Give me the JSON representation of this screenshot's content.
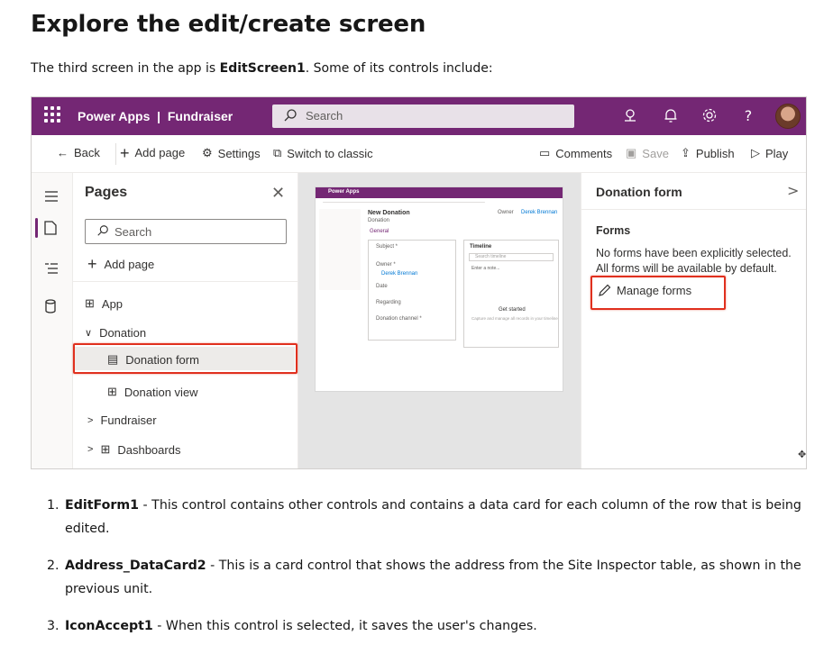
{
  "heading": "Explore the edit/create screen",
  "intro": {
    "before": "The third screen in the app is ",
    "bold": "EditScreen1",
    "after": ". Some of its controls include:"
  },
  "screenshot": {
    "topbar": {
      "app_name": "Power Apps  |  Fundraiser",
      "search_placeholder": "Search",
      "help_glyph": "?"
    },
    "commands": {
      "back": "Back",
      "add_page": "Add page",
      "settings": "Settings",
      "switch": "Switch to classic",
      "comments": "Comments",
      "save": "Save",
      "publish": "Publish",
      "play": "Play"
    },
    "pages_panel": {
      "title": "Pages",
      "search_placeholder": "Search",
      "add_page": "Add page",
      "items": [
        "App",
        "Donation",
        "Donation form",
        "Donation view",
        "Fundraiser",
        "Dashboards"
      ]
    },
    "canvas_preview": {
      "app_label": "Power Apps",
      "form_title": "New Donation",
      "form_subtitle": "Donation",
      "tab": "General",
      "owner_label": "Owner",
      "owner_value": "Derek Brennan",
      "fields": [
        "Subject *",
        "Owner *",
        "Derek Brennan",
        "Date",
        "Regarding",
        "Donation channel *"
      ],
      "timeline": "Timeline",
      "timeline_search": "Search timeline",
      "timeline_note": "Enter a note...",
      "get_started": "Get started",
      "get_started_sub": "Capture and manage all records in your timeline"
    },
    "properties": {
      "title": "Donation form",
      "forms_heading": "Forms",
      "forms_text": "No forms have been explicitly selected. All forms will be available by default.",
      "manage_forms": "Manage forms"
    },
    "colors": {
      "brand": "#742774",
      "highlight": "#e0301e"
    }
  },
  "steps": [
    {
      "num": "1.",
      "term": "EditForm1",
      "text": " - This control contains other controls and contains a data card for each column of the row that is being edited."
    },
    {
      "num": "2.",
      "term": "Address_DataCard2",
      "text": " - This is a card control that shows the address from the Site Inspector table, as shown in the previous unit."
    },
    {
      "num": "3.",
      "term": "IconAccept1",
      "text": " - When this control is selected, it saves the user's changes."
    }
  ]
}
